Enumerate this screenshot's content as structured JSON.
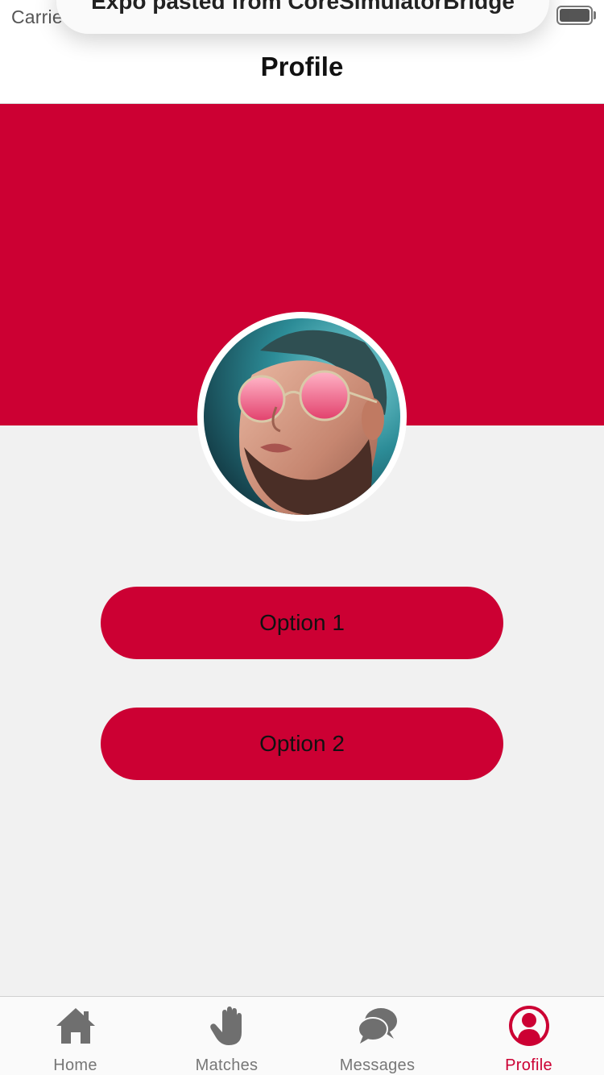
{
  "status_bar": {
    "carrier": "Carrie",
    "banner_text": "Expo pasted from CoreSimulatorBridge"
  },
  "header": {
    "title": "Profile"
  },
  "theme": {
    "accent": "#cc0033",
    "background": "#f1f1f1",
    "inactive": "#777777"
  },
  "profile": {
    "avatar_icon": "avatar-photo"
  },
  "options": [
    {
      "label": "Option 1"
    },
    {
      "label": "Option 2"
    }
  ],
  "tabs": [
    {
      "label": "Home",
      "icon": "home-icon",
      "active": false
    },
    {
      "label": "Matches",
      "icon": "hand-icon",
      "active": false
    },
    {
      "label": "Messages",
      "icon": "chat-bubbles-icon",
      "active": false
    },
    {
      "label": "Profile",
      "icon": "profile-icon",
      "active": true
    }
  ]
}
